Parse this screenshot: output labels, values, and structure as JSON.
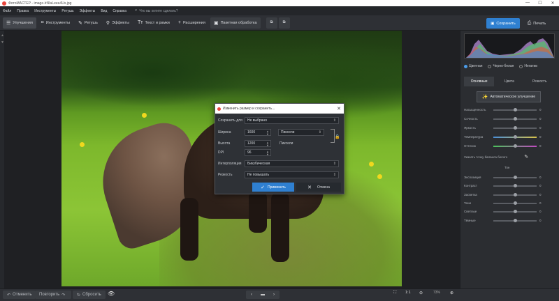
{
  "window": {
    "title": "ФотоМАСТЕР - image-lrNIaLeea4Us.jpg",
    "min": "—",
    "max": "☐",
    "close": "✕"
  },
  "menu": {
    "items": [
      "Файл",
      "Правка",
      "Инструменты",
      "Ретушь",
      "Эффекты",
      "Вид",
      "Справка"
    ],
    "search_placeholder": "Что вы хотите сделать?"
  },
  "toolbar": {
    "tabs": [
      {
        "label": "Улучшения",
        "icon": "sliders-icon"
      },
      {
        "label": "Инструменты",
        "icon": "crop-icon"
      },
      {
        "label": "Ретушь",
        "icon": "brush-icon"
      },
      {
        "label": "Эффекты",
        "icon": "magic-icon"
      },
      {
        "label": "Текст и рамки",
        "icon": "text-icon"
      },
      {
        "label": "Расширения",
        "icon": "plus-icon"
      },
      {
        "label": "Пакетная обработка",
        "icon": "batch-icon"
      }
    ],
    "save_label": "Сохранить",
    "print_label": "Печать"
  },
  "dialog": {
    "title": "Изменить размер и сохранить...",
    "save_for_label": "Сохранить для",
    "save_for_value": "Не выбрано",
    "width_label": "Ширина",
    "width_value": "1600",
    "unit_value": "Пиксели",
    "height_label": "Высота",
    "height_value": "1200",
    "height_unit": "Пиксели",
    "dpi_label": "DPI",
    "dpi_value": "96",
    "interp_label": "Интерполяция",
    "interp_value": "Бикубическая",
    "sharp_label": "Резкость",
    "sharp_value": "Не повышать",
    "apply_label": "Применить",
    "cancel_label": "Отмена"
  },
  "right_panel": {
    "modes": [
      "Цветная",
      "Черно-белая",
      "Негатив"
    ],
    "tabs": [
      "Основные",
      "Цвета",
      "Резкость"
    ],
    "auto_label": "Автоматическое улучшение",
    "sliders_top": [
      {
        "name": "Насыщенность",
        "value": "0"
      },
      {
        "name": "Сочность",
        "value": "0"
      },
      {
        "name": "Яркость",
        "value": "0"
      },
      {
        "name": "Температура",
        "value": "0"
      },
      {
        "name": "Оттенок",
        "value": "0"
      }
    ],
    "wb_label": "Указать точку баланса белого",
    "tone_label": "Тон",
    "sliders_tone": [
      {
        "name": "Экспозиция",
        "value": "0"
      },
      {
        "name": "Контраст",
        "value": "0"
      },
      {
        "name": "Засветка",
        "value": "0"
      },
      {
        "name": "Тени",
        "value": "0"
      },
      {
        "name": "Светлые",
        "value": "0"
      },
      {
        "name": "Тёмные",
        "value": "0"
      }
    ]
  },
  "bottom": {
    "undo_label": "Отменить",
    "redo_label": "Повторить",
    "reset_label": "Сбросить",
    "zoom_fit": "1:1",
    "zoom_value": "73%"
  }
}
